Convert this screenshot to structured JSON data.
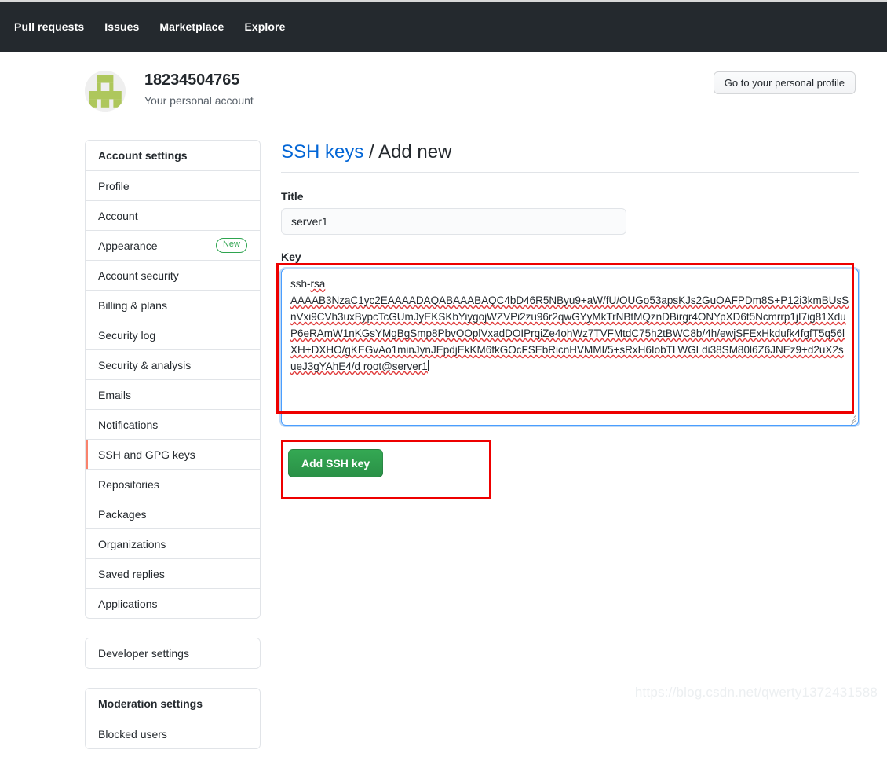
{
  "topnav": {
    "links": [
      {
        "label": "Pull requests"
      },
      {
        "label": "Issues"
      },
      {
        "label": "Marketplace"
      },
      {
        "label": "Explore"
      }
    ],
    "background": "#24292e"
  },
  "account": {
    "name": "18234504765",
    "subtitle": "Your personal account",
    "profile_button": "Go to your personal profile",
    "avatar_icon": "identicon-avatar",
    "avatar_color": "#aec75c"
  },
  "sidebar": {
    "groups": [
      {
        "name": "account-settings",
        "items": [
          {
            "label": "Account settings",
            "type": "header"
          },
          {
            "label": "Profile"
          },
          {
            "label": "Account"
          },
          {
            "label": "Appearance",
            "badge": "New"
          },
          {
            "label": "Account security"
          },
          {
            "label": "Billing & plans"
          },
          {
            "label": "Security log"
          },
          {
            "label": "Security & analysis"
          },
          {
            "label": "Emails"
          },
          {
            "label": "Notifications"
          },
          {
            "label": "SSH and GPG keys",
            "selected": true
          },
          {
            "label": "Repositories"
          },
          {
            "label": "Packages"
          },
          {
            "label": "Organizations"
          },
          {
            "label": "Saved replies"
          },
          {
            "label": "Applications"
          }
        ]
      },
      {
        "name": "developer-settings",
        "items": [
          {
            "label": "Developer settings"
          }
        ]
      },
      {
        "name": "moderation-settings",
        "items": [
          {
            "label": "Moderation settings",
            "type": "header"
          },
          {
            "label": "Blocked users"
          }
        ]
      }
    ],
    "selected_accent": "#f9826c",
    "badge_color": "#2ea44f"
  },
  "main": {
    "title_link": "SSH keys",
    "title_rest": " / Add new",
    "title_label": "Title",
    "title_value": "server1",
    "title_placeholder": "",
    "key_label": "Key",
    "key_placeholder": "",
    "key_value_line1": "ssh-rsa",
    "key_value_line2": "AAAAB3NzaC1yc2EAAAADAQABAAABAQC4bD46R5NByu9+aW/fU/OUGo53apsKJs2GuOAFPDm8S+P12i3kmBUsSnVxi9CVh3uxBypcTcGUmJyEKSKbYiygojWZVPi2zu96r2qwGYyMkTrNBtMQznDBirgr4ONYpXD6t5Ncmrrp1jI7ig81XduP6eRAmW1nKGsYMgBgSmp8PbvOOplVxadDOIPrqiZe4ohWz7TVFMtdC75h2tBWC8b/4h/ewjSFExHkdufk4fgfT5q56lXH+DXHO/gKEGvAo1minJynJEpdjEkKM6fkGOcFSEbRicnHVMMI/5+sRxH6IobTLWGLdi38SM80l6Z6JNEz9+d2uX2sueJ3gYAhE4/d root@server1",
    "submit_label": "Add SSH key",
    "submit_color": "#2ea44f",
    "link_color": "#0366d6",
    "annotation_color": "#ee0000"
  },
  "watermark": "https://blog.csdn.net/qwerty1372431588"
}
